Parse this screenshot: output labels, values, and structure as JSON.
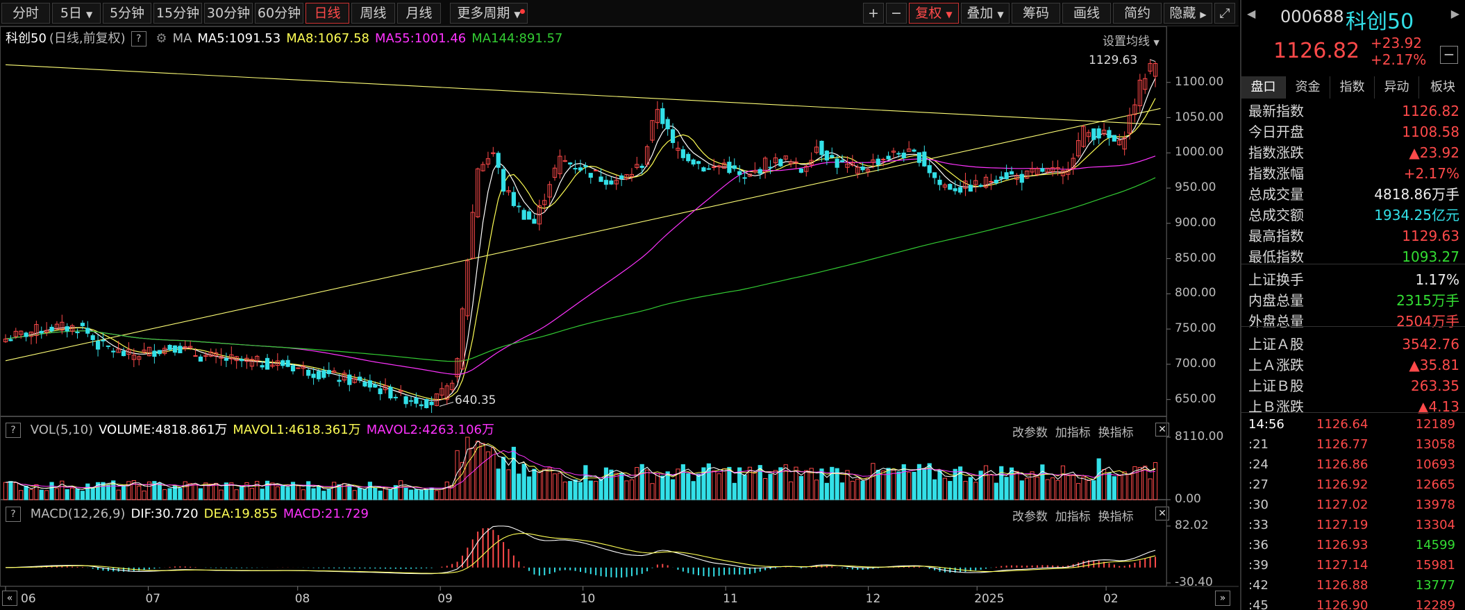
{
  "toolbar": {
    "periods": [
      "分时",
      "5日",
      "5分钟",
      "15分钟",
      "30分钟",
      "60分钟",
      "日线",
      "周线",
      "月线",
      "更多周期"
    ],
    "active_period": "日线",
    "right_buttons": [
      "+",
      "−",
      "复权",
      "叠加",
      "筹码",
      "画线",
      "简约",
      "隐藏"
    ]
  },
  "price_info": {
    "name": "科创50",
    "desc": "(日线,前复权)",
    "ma_label": "MA",
    "ma5": "MA5:1091.53",
    "ma8": "MA8:1067.58",
    "ma55": "MA55:1001.46",
    "ma144": "MA144:891.57",
    "settings": "设置均线"
  },
  "vol_info": {
    "name": "VOL(5,10)",
    "volume": "VOLUME:4818.861万",
    "mavol1": "MAVOL1:4618.361万",
    "mavol2": "MAVOL2:4263.106万"
  },
  "macd_info": {
    "name": "MACD(12,26,9)",
    "dif": "DIF:30.720",
    "dea": "DEA:19.855",
    "macd": "MACD:21.729"
  },
  "panel_buttons": {
    "params": "改参数",
    "add": "加指标",
    "swap": "换指标"
  },
  "colors": {
    "up": "#ff4a4a",
    "down": "#33e0e8",
    "ma5": "#ffffff",
    "ma8": "#ffff55",
    "ma55": "#ff33ff",
    "ma144": "#33cc33",
    "trend": "#ffff77",
    "green": "#33dd33"
  },
  "chart_data": [
    {
      "type": "candlestick",
      "title": "科创50 (日线,前复权)",
      "x_ticks": [
        "06",
        "07",
        "08",
        "09",
        "10",
        "11",
        "12",
        "2025",
        "02"
      ],
      "y_ticks": [
        650,
        700,
        750,
        800,
        850,
        900,
        950,
        1000,
        1050,
        1100
      ],
      "ylim": [
        628,
        1148
      ],
      "annotations": {
        "high": "1129.63",
        "low": "640.35"
      },
      "anchors": [
        [
          0,
          736
        ],
        [
          8,
          752
        ],
        [
          15,
          752
        ],
        [
          18,
          728
        ],
        [
          24,
          712
        ],
        [
          33,
          726
        ],
        [
          38,
          712
        ],
        [
          46,
          704
        ],
        [
          54,
          700
        ],
        [
          62,
          686
        ],
        [
          70,
          672
        ],
        [
          78,
          652
        ],
        [
          83,
          646
        ],
        [
          86,
          662
        ],
        [
          88,
          700
        ],
        [
          90,
          850
        ],
        [
          92,
          980
        ],
        [
          95,
          1000
        ],
        [
          97,
          950
        ],
        [
          100,
          920
        ],
        [
          103,
          900
        ],
        [
          106,
          960
        ],
        [
          108,
          990
        ],
        [
          112,
          980
        ],
        [
          116,
          965
        ],
        [
          120,
          960
        ],
        [
          124,
          985
        ],
        [
          127,
          1065
        ],
        [
          130,
          1010
        ],
        [
          134,
          990
        ],
        [
          137,
          975
        ],
        [
          140,
          985
        ],
        [
          144,
          960
        ],
        [
          148,
          985
        ],
        [
          152,
          990
        ],
        [
          155,
          975
        ],
        [
          158,
          1010
        ],
        [
          162,
          985
        ],
        [
          166,
          975
        ],
        [
          170,
          990
        ],
        [
          174,
          1000
        ],
        [
          178,
          995
        ],
        [
          182,
          955
        ],
        [
          186,
          950
        ],
        [
          190,
          955
        ],
        [
          194,
          970
        ],
        [
          198,
          965
        ],
        [
          202,
          975
        ],
        [
          206,
          970
        ],
        [
          210,
          1030
        ],
        [
          214,
          1025
        ],
        [
          217,
          1010
        ],
        [
          219,
          1050
        ],
        [
          221,
          1095
        ],
        [
          223,
          1126
        ]
      ],
      "ma_values": {
        "MA5": 1091.53,
        "MA8": 1067.58,
        "MA55": 1001.46,
        "MA144": 891.57
      },
      "trendlines": [
        {
          "from": [
            0,
            1125
          ],
          "to": [
            225,
            1040
          ]
        },
        {
          "from": [
            0,
            705
          ],
          "to": [
            225,
            1063
          ]
        }
      ]
    },
    {
      "type": "bar",
      "title": "VOL(5,10)",
      "y_ticks": [
        0,
        8110
      ],
      "ylim": [
        0,
        8110
      ],
      "volume_latest": 4818.861,
      "mavol1": 4618.361,
      "mavol2": 4263.106
    },
    {
      "type": "bar",
      "title": "MACD(12,26,9)",
      "y_ticks": [
        -30.4,
        82.02
      ],
      "ylim": [
        -30.4,
        82.02
      ],
      "dif": 30.72,
      "dea": 19.855,
      "macd": 21.729
    }
  ],
  "sidebar": {
    "code": "000688",
    "name": "科创50",
    "price": "1126.82",
    "change": "+23.92",
    "pct": "+2.17%",
    "tabs": [
      "盘口",
      "资金",
      "指数",
      "异动",
      "板块"
    ],
    "rows": [
      {
        "k": "最新指数",
        "v": "1126.82",
        "c": "up"
      },
      {
        "k": "今日开盘",
        "v": "1108.58",
        "c": "up"
      },
      {
        "k": "指数涨跌",
        "v": "▲23.92",
        "c": "up"
      },
      {
        "k": "指数涨幅",
        "v": "+2.17%",
        "c": "up"
      },
      {
        "k": "总成交量",
        "v": "4818.86万手",
        "c": "white"
      },
      {
        "k": "总成交额",
        "v": "1934.25亿元",
        "c": "cyan"
      },
      {
        "k": "最高指数",
        "v": "1129.63",
        "c": "up"
      },
      {
        "k": "最低指数",
        "v": "1093.27",
        "c": "green"
      },
      {
        "k": "上证换手",
        "v": "1.17%",
        "c": "white"
      },
      {
        "k": "内盘总量",
        "v": "2315万手",
        "c": "green"
      },
      {
        "k": "外盘总量",
        "v": "2504万手",
        "c": "up"
      },
      {
        "k": "上证Ａ股",
        "v": "3542.76",
        "c": "up"
      },
      {
        "k": "上Ａ涨跌",
        "v": "▲35.81",
        "c": "up"
      },
      {
        "k": "上证Ｂ股",
        "v": "263.35",
        "c": "up"
      },
      {
        "k": "上Ｂ涨跌",
        "v": "▲4.13",
        "c": "up"
      }
    ],
    "ticks": [
      {
        "t": "14:56",
        "p": "1126.64",
        "q": "12189",
        "c": "up"
      },
      {
        "t": ":21",
        "p": "1126.77",
        "q": "13058",
        "c": "up"
      },
      {
        "t": ":24",
        "p": "1126.86",
        "q": "10693",
        "c": "up"
      },
      {
        "t": ":27",
        "p": "1126.92",
        "q": "12665",
        "c": "up"
      },
      {
        "t": ":30",
        "p": "1127.02",
        "q": "13978",
        "c": "up"
      },
      {
        "t": ":33",
        "p": "1127.19",
        "q": "13304",
        "c": "up"
      },
      {
        "t": ":36",
        "p": "1126.93",
        "q": "14599",
        "c": "green"
      },
      {
        "t": ":39",
        "p": "1127.14",
        "q": "15981",
        "c": "up"
      },
      {
        "t": ":42",
        "p": "1126.88",
        "q": "13777",
        "c": "green"
      },
      {
        "t": ":45",
        "p": "1126.90",
        "q": "12289",
        "c": "up"
      }
    ]
  }
}
